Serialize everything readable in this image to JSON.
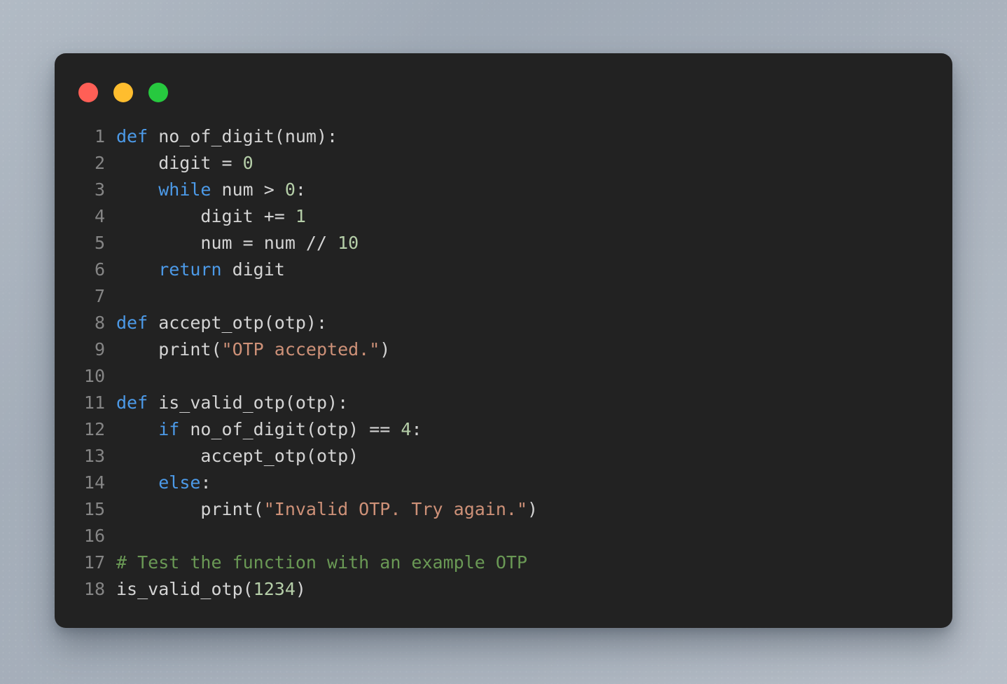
{
  "window": {
    "background_start_color": "#a9b3be",
    "background_end_color": "#b2bac4",
    "card_background_color": "#222222"
  },
  "titlebar": {
    "controls": [
      {
        "name": "close-button",
        "color": "#ff5f56"
      },
      {
        "name": "minimize-button",
        "color": "#ffbd2e"
      },
      {
        "name": "maximize-button",
        "color": "#27c93f"
      }
    ]
  },
  "editor": {
    "language": "python",
    "default_text_color": "#d4d4d4",
    "line_number_color": "#858585",
    "syntax_colors": {
      "keyword": "#4c9ae8",
      "string": "#ce9178",
      "number": "#b5cea8",
      "comment": "#6a9955"
    },
    "lines": [
      {
        "number": "1",
        "tokens": [
          {
            "t": "kw",
            "v": "def"
          },
          {
            "t": "def",
            "v": " no_of_digit(num):"
          }
        ]
      },
      {
        "number": "2",
        "tokens": [
          {
            "t": "def",
            "v": "    digit = "
          },
          {
            "t": "num",
            "v": "0"
          }
        ]
      },
      {
        "number": "3",
        "tokens": [
          {
            "t": "def",
            "v": "    "
          },
          {
            "t": "kw",
            "v": "while"
          },
          {
            "t": "def",
            "v": " num > "
          },
          {
            "t": "num",
            "v": "0"
          },
          {
            "t": "def",
            "v": ":"
          }
        ]
      },
      {
        "number": "4",
        "tokens": [
          {
            "t": "def",
            "v": "        digit += "
          },
          {
            "t": "num",
            "v": "1"
          }
        ]
      },
      {
        "number": "5",
        "tokens": [
          {
            "t": "def",
            "v": "        num = num // "
          },
          {
            "t": "num",
            "v": "10"
          }
        ]
      },
      {
        "number": "6",
        "tokens": [
          {
            "t": "def",
            "v": "    "
          },
          {
            "t": "kw",
            "v": "return"
          },
          {
            "t": "def",
            "v": " digit"
          }
        ]
      },
      {
        "number": "7",
        "tokens": []
      },
      {
        "number": "8",
        "tokens": [
          {
            "t": "kw",
            "v": "def"
          },
          {
            "t": "def",
            "v": " accept_otp(otp):"
          }
        ]
      },
      {
        "number": "9",
        "tokens": [
          {
            "t": "def",
            "v": "    print("
          },
          {
            "t": "str",
            "v": "\"OTP accepted.\""
          },
          {
            "t": "def",
            "v": ")"
          }
        ]
      },
      {
        "number": "10",
        "tokens": []
      },
      {
        "number": "11",
        "tokens": [
          {
            "t": "kw",
            "v": "def"
          },
          {
            "t": "def",
            "v": " is_valid_otp(otp):"
          }
        ]
      },
      {
        "number": "12",
        "tokens": [
          {
            "t": "def",
            "v": "    "
          },
          {
            "t": "kw",
            "v": "if"
          },
          {
            "t": "def",
            "v": " no_of_digit(otp) == "
          },
          {
            "t": "num",
            "v": "4"
          },
          {
            "t": "def",
            "v": ":"
          }
        ]
      },
      {
        "number": "13",
        "tokens": [
          {
            "t": "def",
            "v": "        accept_otp(otp)"
          }
        ]
      },
      {
        "number": "14",
        "tokens": [
          {
            "t": "def",
            "v": "    "
          },
          {
            "t": "kw",
            "v": "else"
          },
          {
            "t": "def",
            "v": ":"
          }
        ]
      },
      {
        "number": "15",
        "tokens": [
          {
            "t": "def",
            "v": "        print("
          },
          {
            "t": "str",
            "v": "\"Invalid OTP. Try again.\""
          },
          {
            "t": "def",
            "v": ")"
          }
        ]
      },
      {
        "number": "16",
        "tokens": []
      },
      {
        "number": "17",
        "tokens": [
          {
            "t": "com",
            "v": "# Test the function with an example OTP"
          }
        ]
      },
      {
        "number": "18",
        "tokens": [
          {
            "t": "def",
            "v": "is_valid_otp("
          },
          {
            "t": "num",
            "v": "1234"
          },
          {
            "t": "def",
            "v": ")"
          }
        ]
      }
    ]
  }
}
